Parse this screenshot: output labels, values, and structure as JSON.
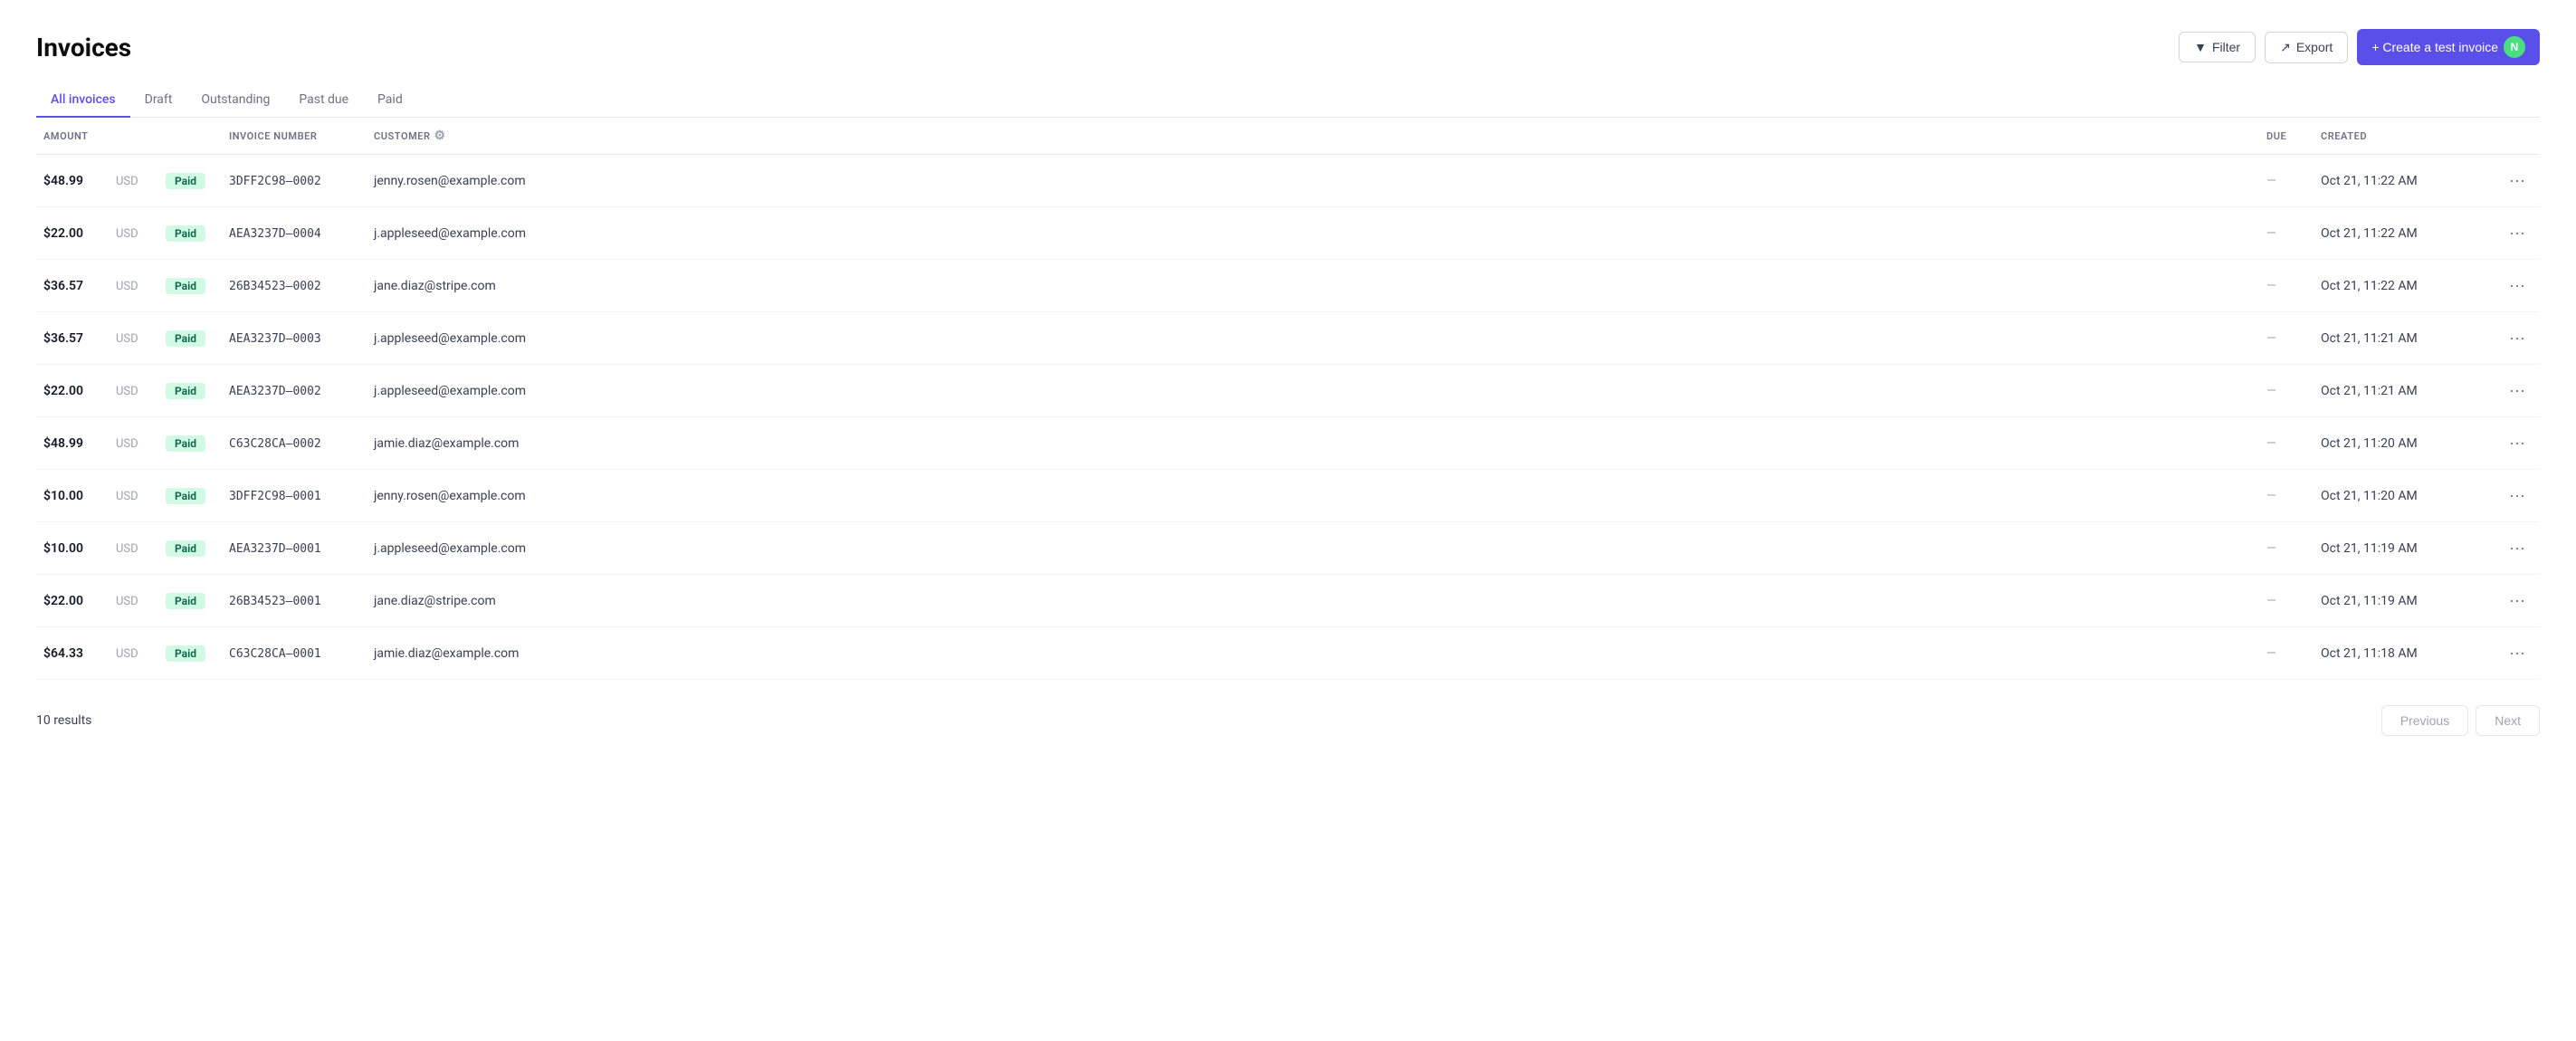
{
  "page": {
    "title": "Invoices"
  },
  "tabs": [
    {
      "id": "all",
      "label": "All invoices",
      "active": true
    },
    {
      "id": "draft",
      "label": "Draft",
      "active": false
    },
    {
      "id": "outstanding",
      "label": "Outstanding",
      "active": false
    },
    {
      "id": "past-due",
      "label": "Past due",
      "active": false
    },
    {
      "id": "paid",
      "label": "Paid",
      "active": false
    }
  ],
  "toolbar": {
    "filter_label": "Filter",
    "export_label": "Export",
    "create_label": "+ Create a test invoice",
    "avatar_label": "N"
  },
  "table": {
    "columns": {
      "amount": "AMOUNT",
      "invoice_number": "INVOICE NUMBER",
      "customer": "CUSTOMER",
      "due": "DUE",
      "created": "CREATED"
    },
    "rows": [
      {
        "amount": "$48.99",
        "currency": "USD",
        "status": "Paid",
        "invoice_number": "3DFF2C98–0002",
        "customer": "jenny.rosen@example.com",
        "due": "—",
        "created": "Oct 21, 11:22 AM"
      },
      {
        "amount": "$22.00",
        "currency": "USD",
        "status": "Paid",
        "invoice_number": "AEA3237D–0004",
        "customer": "j.appleseed@example.com",
        "due": "—",
        "created": "Oct 21, 11:22 AM"
      },
      {
        "amount": "$36.57",
        "currency": "USD",
        "status": "Paid",
        "invoice_number": "26B34523–0002",
        "customer": "jane.diaz@stripe.com",
        "due": "—",
        "created": "Oct 21, 11:22 AM"
      },
      {
        "amount": "$36.57",
        "currency": "USD",
        "status": "Paid",
        "invoice_number": "AEA3237D–0003",
        "customer": "j.appleseed@example.com",
        "due": "—",
        "created": "Oct 21, 11:21 AM"
      },
      {
        "amount": "$22.00",
        "currency": "USD",
        "status": "Paid",
        "invoice_number": "AEA3237D–0002",
        "customer": "j.appleseed@example.com",
        "due": "—",
        "created": "Oct 21, 11:21 AM"
      },
      {
        "amount": "$48.99",
        "currency": "USD",
        "status": "Paid",
        "invoice_number": "C63C28CA–0002",
        "customer": "jamie.diaz@example.com",
        "due": "—",
        "created": "Oct 21, 11:20 AM"
      },
      {
        "amount": "$10.00",
        "currency": "USD",
        "status": "Paid",
        "invoice_number": "3DFF2C98–0001",
        "customer": "jenny.rosen@example.com",
        "due": "—",
        "created": "Oct 21, 11:20 AM"
      },
      {
        "amount": "$10.00",
        "currency": "USD",
        "status": "Paid",
        "invoice_number": "AEA3237D–0001",
        "customer": "j.appleseed@example.com",
        "due": "—",
        "created": "Oct 21, 11:19 AM"
      },
      {
        "amount": "$22.00",
        "currency": "USD",
        "status": "Paid",
        "invoice_number": "26B34523–0001",
        "customer": "jane.diaz@stripe.com",
        "due": "—",
        "created": "Oct 21, 11:19 AM"
      },
      {
        "amount": "$64.33",
        "currency": "USD",
        "status": "Paid",
        "invoice_number": "C63C28CA–0001",
        "customer": "jamie.diaz@example.com",
        "due": "—",
        "created": "Oct 21, 11:18 AM"
      }
    ]
  },
  "footer": {
    "results_count": "10 results",
    "previous_label": "Previous",
    "next_label": "Next"
  }
}
